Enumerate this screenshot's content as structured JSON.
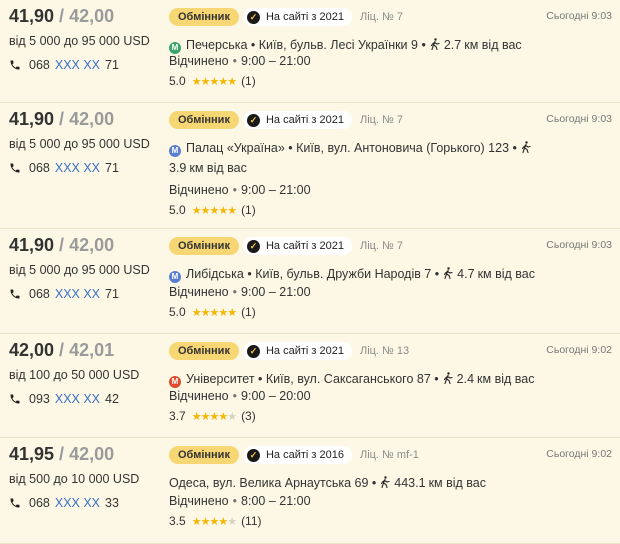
{
  "colors": {
    "background": "#fdf8e6",
    "badge": "#f7d774",
    "link": "#3a6fc7",
    "star": "#f2b705",
    "metro_green": "#3aa36c",
    "metro_blue": "#5a7fd1",
    "metro_red": "#e04a2a"
  },
  "listings": [
    {
      "buy": "41,90",
      "sell": "42,00",
      "limits": "від 5 000 до 95 000 USD",
      "phone": {
        "prefix": "068",
        "hidden": "XXX XX",
        "suffix": "71"
      },
      "type": "Обмінник",
      "on_site": "На сайті з 2021",
      "license": "Ліц. № 7",
      "time": "Сьогодні 9:03",
      "metro": {
        "name": "Печерська",
        "color": "green",
        "letter": "М"
      },
      "address": "Київ, бульв. Лесі Українки 9",
      "distance": "2.7",
      "distance_unit": "км від вас",
      "status": "Відчинено",
      "hours": "9:00 – 21:00",
      "rating": "5.0",
      "stars": 5,
      "reviews": "(1)"
    },
    {
      "buy": "41,90",
      "sell": "42,00",
      "limits": "від 5 000 до 95 000 USD",
      "phone": {
        "prefix": "068",
        "hidden": "XXX XX",
        "suffix": "71"
      },
      "type": "Обмінник",
      "on_site": "На сайті з 2021",
      "license": "Ліц. № 7",
      "time": "Сьогодні 9:03",
      "metro": {
        "name": "Палац «Україна»",
        "color": "blue",
        "letter": "М"
      },
      "address": "Київ, вул. Антоновича (Горького) 123",
      "distance": "3.9",
      "distance_unit": "км від вас",
      "status": "Відчинено",
      "hours": "9:00 – 21:00",
      "rating": "5.0",
      "stars": 5,
      "reviews": "(1)"
    },
    {
      "buy": "41,90",
      "sell": "42,00",
      "limits": "від 5 000 до 95 000 USD",
      "phone": {
        "prefix": "068",
        "hidden": "XXX XX",
        "suffix": "71"
      },
      "type": "Обмінник",
      "on_site": "На сайті з 2021",
      "license": "Ліц. № 7",
      "time": "Сьогодні 9:03",
      "metro": {
        "name": "Либідська",
        "color": "blue",
        "letter": "М"
      },
      "address": "Київ, бульв. Дружби Народів 7",
      "distance": "4.7",
      "distance_unit": "км від вас",
      "status": "Відчинено",
      "hours": "9:00 – 21:00",
      "rating": "5.0",
      "stars": 5,
      "reviews": "(1)"
    },
    {
      "buy": "42,00",
      "sell": "42,01",
      "limits": "від 100 до 50 000 USD",
      "phone": {
        "prefix": "093",
        "hidden": "XXX XX",
        "suffix": "42"
      },
      "type": "Обмінник",
      "on_site": "На сайті з 2021",
      "license": "Ліц. № 13",
      "time": "Сьогодні 9:02",
      "metro": {
        "name": "Університет",
        "color": "red",
        "letter": "М"
      },
      "address": "Київ, вул. Саксаганського 87",
      "distance": "2.4",
      "distance_unit": "км від вас",
      "status": "Відчинено",
      "hours": "9:00 – 20:00",
      "rating": "3.7",
      "stars": 3.5,
      "reviews": "(3)"
    },
    {
      "buy": "41,95",
      "sell": "42,00",
      "limits": "від 500 до 10 000 USD",
      "phone": {
        "prefix": "068",
        "hidden": "XXX XX",
        "suffix": "33"
      },
      "type": "Обмінник",
      "on_site": "На сайті з 2016",
      "license": "Ліц. № mf-1",
      "time": "Сьогодні 9:02",
      "metro": null,
      "address": "Одеса, вул. Велика Арнаутська 69",
      "distance": "443.1",
      "distance_unit": "км від вас",
      "status": "Відчинено",
      "hours": "8:00 – 21:00",
      "rating": "3.5",
      "stars": 3.5,
      "reviews": "(11)"
    }
  ]
}
